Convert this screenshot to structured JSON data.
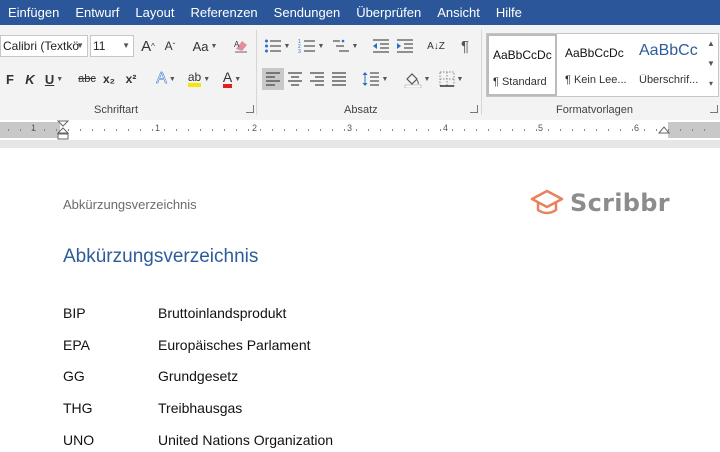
{
  "menu": [
    "Einfügen",
    "Entwurf",
    "Layout",
    "Referenzen",
    "Sendungen",
    "Überprüfen",
    "Ansicht",
    "Hilfe"
  ],
  "ribbon": {
    "font_name": "Calibri (Textkö",
    "font_size": "11",
    "groups": [
      "Schriftart",
      "Absatz",
      "Formatvorlagen"
    ],
    "buttons": {
      "grow": "A",
      "shrink": "A",
      "case": "Aa",
      "bold": "F",
      "italic": "K",
      "underline": "U",
      "strike": "abc",
      "subscript": "x₂",
      "superscript": "x²",
      "effects": "A",
      "highlight": "ab",
      "font_color": "A",
      "sort": "A↓Z",
      "pilcrow": "¶"
    },
    "styles": [
      {
        "sample": "AaBbCcDc",
        "name": "¶ Standard"
      },
      {
        "sample": "AaBbCcDc",
        "name": "¶ Kein Lee..."
      },
      {
        "sample": "AaBbCc",
        "name": "Überschrif..."
      }
    ]
  },
  "ruler": {
    "numbers": [
      "1",
      "1",
      "2",
      "3",
      "4",
      "5",
      "6"
    ]
  },
  "document": {
    "header": "Abkürzungsverzeichnis",
    "logo_text": "Scribbr",
    "title": "Abkürzungsverzeichnis",
    "entries": [
      {
        "abbr": "BIP",
        "full": "Bruttoinlandsprodukt"
      },
      {
        "abbr": "EPA",
        "full": "Europäisches Parlament"
      },
      {
        "abbr": "GG",
        "full": "Grundgesetz"
      },
      {
        "abbr": "THG",
        "full": "Treibhausgas"
      },
      {
        "abbr": "UNO",
        "full": "United Nations Organization"
      }
    ]
  },
  "colors": {
    "menubar": "#2b579a",
    "title": "#2e5c9a",
    "logo_accent": "#e8825c",
    "highlight": "#f5e50b",
    "font_color": "#e0201c"
  }
}
